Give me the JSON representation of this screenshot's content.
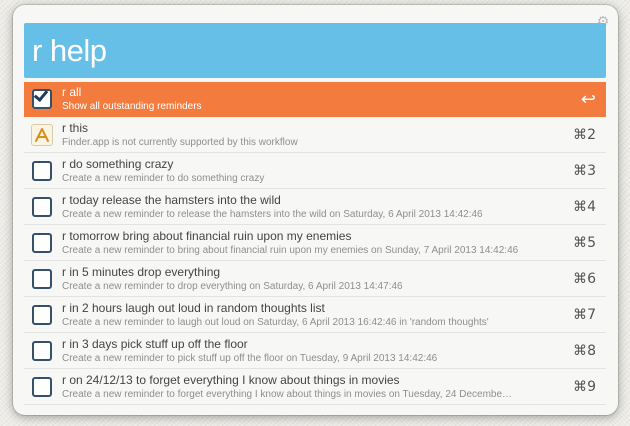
{
  "query": "r help",
  "results": [
    {
      "title": "r all",
      "subtitle": "Show all outstanding reminders",
      "shortcut": "↩",
      "icon": "checkbox-checked-icon",
      "selected": true
    },
    {
      "title": "r this",
      "subtitle": "Finder.app is not currently supported by this workflow",
      "shortcut": "⌘2",
      "icon": "app-icon"
    },
    {
      "title": "r do something crazy",
      "subtitle": "Create a new reminder to do something crazy",
      "shortcut": "⌘3",
      "icon": "checkbox-icon"
    },
    {
      "title": "r today release the hamsters into the wild",
      "subtitle": "Create a new reminder to release the hamsters into the wild on Saturday, 6 April 2013 14:42:46",
      "shortcut": "⌘4",
      "icon": "checkbox-icon"
    },
    {
      "title": "r tomorrow bring about financial ruin upon my enemies",
      "subtitle": "Create a new reminder to bring about financial ruin upon my enemies on Sunday, 7 April 2013 14:42:46",
      "shortcut": "⌘5",
      "icon": "checkbox-icon"
    },
    {
      "title": "r in 5 minutes drop everything",
      "subtitle": "Create a new reminder to drop everything on Saturday, 6 April 2013 14:47:46",
      "shortcut": "⌘6",
      "icon": "checkbox-icon"
    },
    {
      "title": "r in 2 hours laugh out loud in random thoughts list",
      "subtitle": "Create a new reminder to laugh out loud on Saturday, 6 April 2013 16:42:46 in 'random thoughts'",
      "shortcut": "⌘7",
      "icon": "checkbox-icon"
    },
    {
      "title": "r in 3 days pick stuff up off the floor",
      "subtitle": "Create a new reminder to pick stuff up off the floor on Tuesday, 9 April 2013 14:42:46",
      "shortcut": "⌘8",
      "icon": "checkbox-icon"
    },
    {
      "title": "r on 24/12/13 to forget everything I know about things in movies",
      "subtitle": "Create a new reminder to forget everything I know about things in movies on Tuesday, 24 Decembe…",
      "shortcut": "⌘9",
      "icon": "checkbox-icon"
    }
  ],
  "colors": {
    "query_bg": "#66bfe6",
    "selected_bg": "#f47b3e"
  }
}
